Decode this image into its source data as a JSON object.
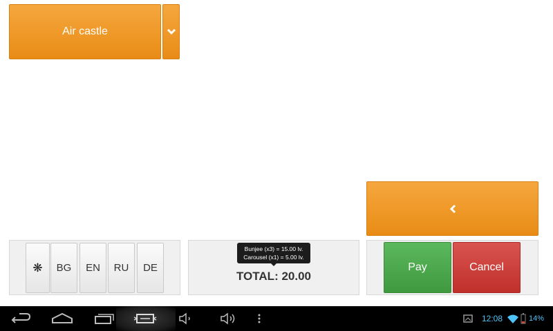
{
  "product": {
    "selected": "Air castle",
    "dropdown_icon": "chevron-down-icon"
  },
  "back_button": {
    "icon": "chevron-left-icon"
  },
  "languages": {
    "star": "❋",
    "items": [
      "BG",
      "EN",
      "RU",
      "DE"
    ]
  },
  "order": {
    "lines": [
      "Bunjee (x3) = 15.00 lv.",
      "Carousel (x1) = 5.00 lv."
    ],
    "total": "TOTAL: 20.00"
  },
  "actions": {
    "pay": "Pay",
    "cancel": "Cancel"
  },
  "colors": {
    "accent_orange": "#F0A030",
    "pay_green": "#4CAF50",
    "cancel_red": "#D0403A",
    "status_blue": "#4FC3F7"
  },
  "status_bar": {
    "time": "12:08",
    "battery": "14%"
  }
}
